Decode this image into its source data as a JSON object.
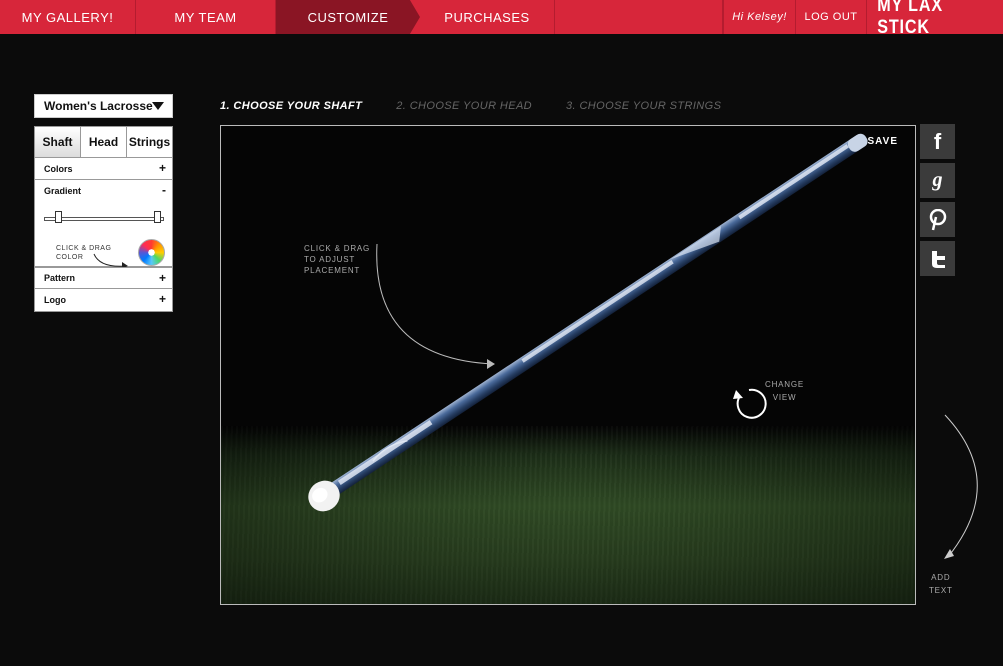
{
  "nav": {
    "gallery": "MY GALLERY!",
    "team": "MY TEAM",
    "customize": "CUSTOMIZE",
    "purchases": "PURCHASES",
    "greeting": "Hi Kelsey!",
    "logout": "LOG OUT",
    "brand": "MY LAX STICK"
  },
  "sidebar": {
    "sport": "Women's Lacrosse",
    "tabs": [
      "Shaft",
      "Head",
      "Strings"
    ],
    "active_tab": "Shaft",
    "sections": {
      "colors": {
        "label": "Colors",
        "toggle": "+"
      },
      "gradient": {
        "label": "Gradient",
        "toggle": "-",
        "hint_line1": "CLICK & DRAG",
        "hint_line2": "COLOR"
      },
      "pattern": {
        "label": "Pattern",
        "toggle": "+"
      },
      "logo": {
        "label": "Logo",
        "toggle": "+"
      }
    }
  },
  "steps": [
    "1. CHOOSE YOUR SHAFT",
    "2. CHOOSE YOUR HEAD",
    "3. CHOOSE YOUR STRINGS"
  ],
  "canvas": {
    "save": "SAVE",
    "drag_hint": [
      "CLICK & DRAG",
      "TO ADJUST",
      "PLACEMENT"
    ],
    "change_view": [
      "CHANGE",
      "VIEW"
    ]
  },
  "social": [
    "facebook-icon",
    "google-plus-icon",
    "pinterest-icon",
    "twitter-icon"
  ],
  "add_text": [
    "ADD",
    "TEXT"
  ],
  "colors": {
    "nav_red": "#d7263a",
    "nav_active": "#8a1524",
    "background": "#0b0b0b",
    "shaft_blue": "#3a5a8a"
  }
}
